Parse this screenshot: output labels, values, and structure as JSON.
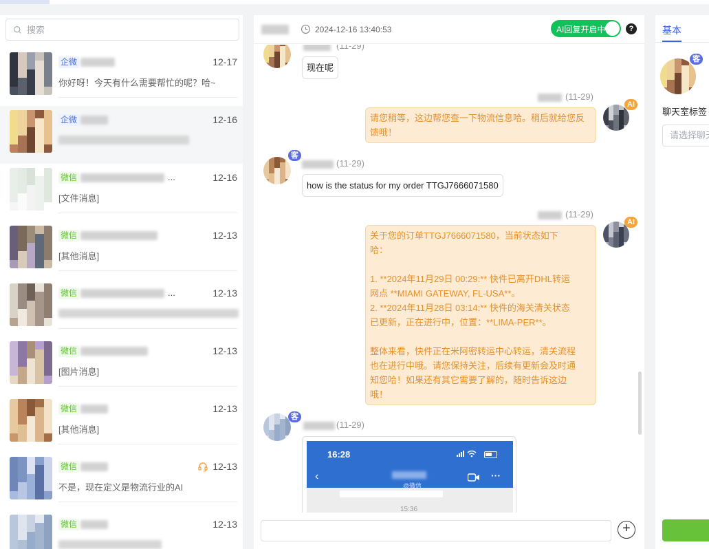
{
  "search": {
    "placeholder": "搜索"
  },
  "conversations": [
    {
      "tag": "企微",
      "tag_type": "qw",
      "date": "12-17",
      "preview": "你好呀！今天有什么需要帮忙的呢？哈~"
    },
    {
      "tag": "企微",
      "tag_type": "qw",
      "date": "12-16",
      "preview": ""
    },
    {
      "tag": "微信",
      "tag_type": "wx",
      "date": "12-16",
      "preview": "[文件消息]",
      "name_suffix": "..."
    },
    {
      "tag": "微信",
      "tag_type": "wx",
      "date": "12-13",
      "preview": "[其他消息]"
    },
    {
      "tag": "微信",
      "tag_type": "wx",
      "date": "12-13",
      "preview": "",
      "name_suffix": "..."
    },
    {
      "tag": "微信",
      "tag_type": "wx",
      "date": "12-13",
      "preview": "[图片消息]"
    },
    {
      "tag": "微信",
      "tag_type": "wx",
      "date": "12-13",
      "preview": "[其他消息]"
    },
    {
      "tag": "微信",
      "tag_type": "wx",
      "date": "12-13",
      "preview": "不是，现在定义是物流行业的AI",
      "icon": "headset-icon"
    },
    {
      "tag": "微信",
      "tag_type": "wx",
      "date": "12-13",
      "preview": ""
    }
  ],
  "chat_header": {
    "time": "2024-12-16 13:40:53",
    "ai_toggle_label": "AI回复开启中",
    "ai_toggle_on": true,
    "help": "?"
  },
  "messages": [
    {
      "dir": "in",
      "time": "(11-29)",
      "text": "现在呢"
    },
    {
      "dir": "out",
      "badge": "AI",
      "time": "(11-29)",
      "text": "请您稍等，这边帮您查一下物流信息哈。稍后就给您反馈哦！"
    },
    {
      "dir": "in",
      "badge": "客",
      "time": "(11-29)",
      "text": "how is the status for my order TTGJ7666071580"
    },
    {
      "dir": "out",
      "badge": "AI",
      "time": "(11-29)",
      "lines": [
        "关于您的订单TTGJ7666071580，当前状态如下",
        "哈：",
        "",
        "1. **2024年11月29日 00:29:** 快件已离开DHL转运",
        "网点 **MIAMI GATEWAY, FL-USA**。",
        "2. **2024年11月28日 03:14:** 快件的海关清关状态",
        "已更新，正在进行中，位置：**LIMA-PER**。",
        "",
        "整体来看，快件正在米阿密转运中心转运，清关流程",
        "也在进行中哦。请您保持关注，后续有更新会及时通",
        "知您哈！如果还有其它需要了解的，随时告诉这边",
        "哦！"
      ]
    },
    {
      "dir": "in",
      "badge": "客",
      "time": "(11-29)",
      "image": {
        "status_time": "16:28",
        "subtitle": "@微信",
        "body_time": "15:36"
      }
    }
  ],
  "right_panel": {
    "tab": "基本",
    "avatar_badge": "客",
    "label": "聊天室标签",
    "select_placeholder": "请选择聊天室标签"
  },
  "colors": {
    "accent": "#3a62d7",
    "toggle_green": "#13c15b",
    "ai_badge": "#f3a43a",
    "ke_badge": "#5b6ee1",
    "ai_bubble_bg": "#fdebd3",
    "ai_text": "#e6912b",
    "wx_tag": "#67c23a",
    "qw_tag": "#4b6fd6"
  }
}
